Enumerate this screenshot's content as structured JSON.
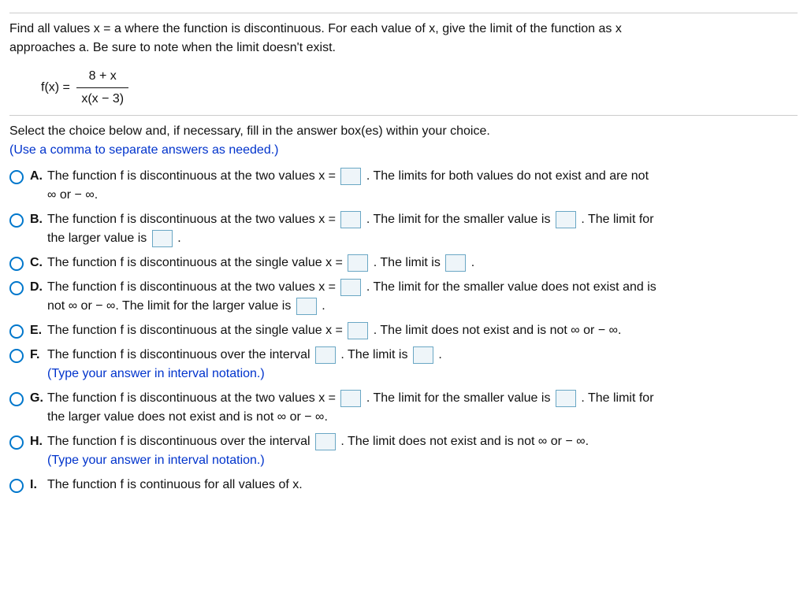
{
  "question": {
    "prompt_line1": "Find all values x = a where the function is discontinuous. For each value of x, give the limit of the function as x",
    "prompt_line2": "approaches a. Be sure to note when the limit doesn't exist.",
    "func_lhs": "f(x) =",
    "frac_num": "8 + x",
    "frac_den": "x(x − 3)"
  },
  "instructions": {
    "line1": "Select the choice below and, if necessary, fill in the answer box(es) within your choice.",
    "line2": "(Use a comma to separate answers as needed.)"
  },
  "options": {
    "A": {
      "label": "A.",
      "part1": "The function f is discontinuous at the two values x =",
      "part2": ". The limits for both values do not exist and are not",
      "part3": "∞ or − ∞."
    },
    "B": {
      "label": "B.",
      "part1": "The function f is discontinuous at the two values x =",
      "part2": ". The limit for the smaller value is",
      "part3": ". The limit for",
      "part4": "the larger value is",
      "part5": "."
    },
    "C": {
      "label": "C.",
      "part1": "The function f is discontinuous at the single value x =",
      "part2": ". The limit is",
      "part3": "."
    },
    "D": {
      "label": "D.",
      "part1": "The function f is discontinuous at the two values x =",
      "part2": ". The limit for the smaller value does not exist and is",
      "part3": "not ∞ or − ∞. The limit for the larger value is",
      "part4": "."
    },
    "E": {
      "label": "E.",
      "part1": "The function f is discontinuous at the single value x =",
      "part2": ". The limit does not exist and is not ∞ or − ∞."
    },
    "F": {
      "label": "F.",
      "part1": "The function f is discontinuous over the interval",
      "part2": ". The limit is",
      "part3": ".",
      "hint": "(Type your answer in interval notation.)"
    },
    "G": {
      "label": "G.",
      "part1": "The function f is discontinuous at the two values x =",
      "part2": ". The limit for the smaller value is",
      "part3": ". The limit for",
      "part4": "the larger value does not exist and is not ∞ or − ∞."
    },
    "H": {
      "label": "H.",
      "part1": "The function f is discontinuous over the interval",
      "part2": ". The limit does not exist and is not ∞ or − ∞.",
      "hint": "(Type your answer in interval notation.)"
    },
    "I": {
      "label": "I.",
      "part1": "The function f is continuous for all values of x."
    }
  }
}
